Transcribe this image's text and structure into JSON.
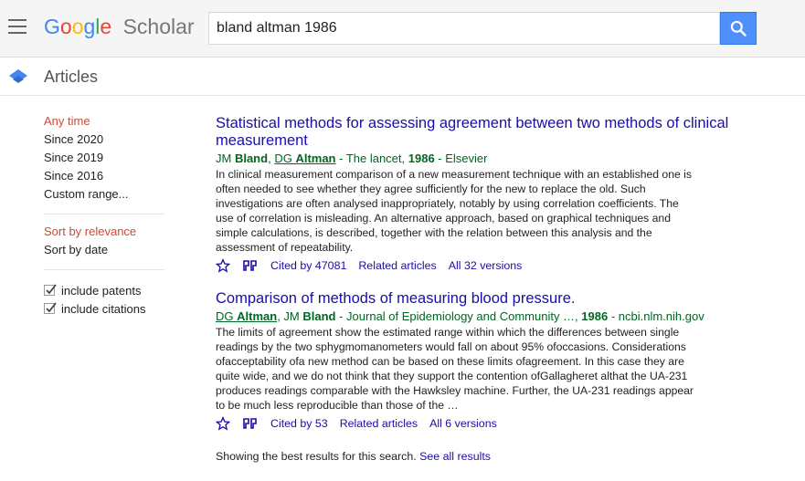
{
  "header": {
    "logo_google": "Google",
    "logo_scholar": "Scholar",
    "search_value": "bland altman 1986"
  },
  "subbar": {
    "title": "Articles"
  },
  "sidebar": {
    "time_filters": [
      "Any time",
      "Since 2020",
      "Since 2019",
      "Since 2016",
      "Custom range..."
    ],
    "sort_options": [
      "Sort by relevance",
      "Sort by date"
    ],
    "checkboxes": [
      {
        "label": "include patents",
        "checked": true
      },
      {
        "label": "include citations",
        "checked": true
      }
    ]
  },
  "results": [
    {
      "title": "Statistical methods for assessing agreement between two methods of clinical measurement",
      "meta": {
        "a1_pre": "JM ",
        "a1_bold": "Bland",
        "sep1": ", ",
        "a2_pre": "DG ",
        "a2_bold": "Altman",
        "rest": " - The lancet, ",
        "year": "1986",
        "tail": " - Elsevier"
      },
      "snippet": "In clinical measurement comparison of a new measurement technique with an established one is often needed to see whether they agree sufficiently for the new to replace the old. Such investigations are often analysed inappropriately, notably by using correlation coefficients. The use of correlation is misleading. An alternative approach, based on graphical techniques and simple calculations, is described, together with the relation between this analysis and the assessment of repeatability.",
      "cited_by": "Cited by 47081",
      "related": "Related articles",
      "versions": "All 32 versions"
    },
    {
      "title": "Comparison of methods of measuring blood pressure.",
      "meta": {
        "a1_pre": "DG ",
        "a1_bold": "Altman",
        "sep1": ", ",
        "a2_pre": "JM ",
        "a2_bold": "Bland",
        "rest": " - Journal of Epidemiology and Community …, ",
        "year": "1986",
        "tail": " - ncbi.nlm.nih.gov"
      },
      "snippet": "The limits of agreement show the estimated range within which the differences between single readings by the two sphygmomanometers would fall on about 95% ofoccasions. Considerations ofacceptability ofa new method can be based on these limits ofagreement. In this case they are quite wide, and we do not think that they support the contention ofGallagheret althat the UA-231 produces readings comparable with the Hawksley machine. Further, the UA-231 readings appear to be much less reproducible than those of the …",
      "cited_by": "Cited by 53",
      "related": "Related articles",
      "versions": "All 6 versions"
    }
  ],
  "footer": {
    "showing_text": "Showing the best results for this search.",
    "see_all": "See all results"
  },
  "colors": {
    "link": "#1a0dab",
    "meta_green": "#006621",
    "active_red": "#d14836",
    "search_blue": "#4d90fe"
  }
}
